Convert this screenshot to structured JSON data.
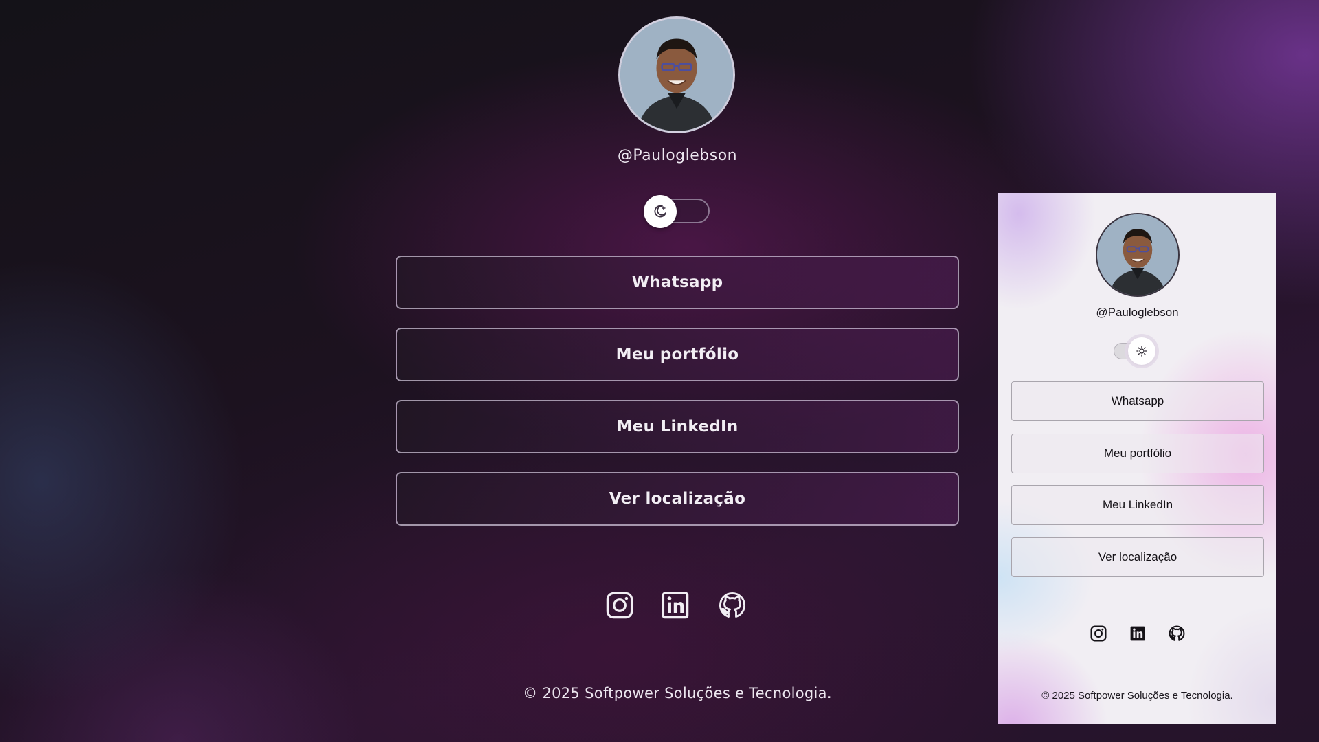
{
  "profile": {
    "username": "@Pauloglebson",
    "avatar_alt": "profile photo"
  },
  "links": [
    {
      "label": "Whatsapp"
    },
    {
      "label": "Meu portfólio"
    },
    {
      "label": "Meu LinkedIn"
    },
    {
      "label": "Ver localização"
    }
  ],
  "social": [
    "instagram-icon",
    "linkedin-icon",
    "github-icon"
  ],
  "footer": {
    "text": "© 2025 Softpower Soluções e Tecnologia."
  },
  "theme_toggle": {
    "dark_mode_icon": "moon-icon",
    "light_mode_icon": "sun-icon"
  },
  "colors": {
    "dark_text": "#ece6ef",
    "light_text": "#1b171e",
    "accent_purple": "#7a3a8e"
  }
}
